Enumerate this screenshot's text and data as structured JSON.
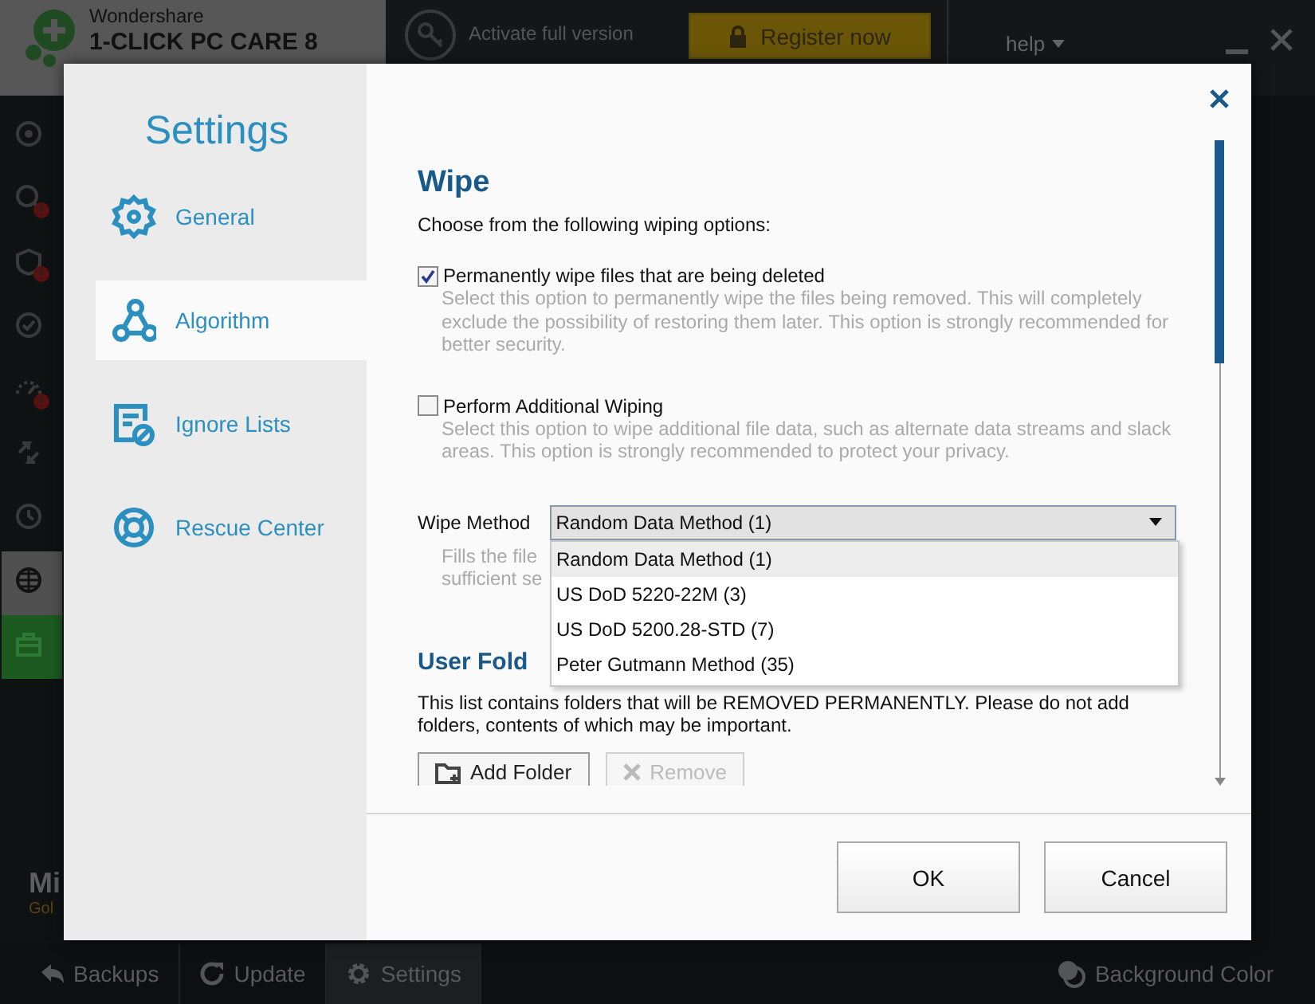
{
  "app": {
    "brand": "Wondershare",
    "product": "1-CLICK PC CARE 8",
    "activate": "Activate full version",
    "register": "Register now",
    "help": "help",
    "side_icons": [
      {
        "kind": "target",
        "alert": false,
        "selected": false
      },
      {
        "kind": "search",
        "alert": true,
        "selected": false
      },
      {
        "kind": "shield",
        "alert": true,
        "selected": false
      },
      {
        "kind": "check",
        "alert": false,
        "selected": false
      },
      {
        "kind": "gauge",
        "alert": true,
        "selected": false
      },
      {
        "kind": "arrows",
        "alert": false,
        "selected": false
      },
      {
        "kind": "clock",
        "alert": false,
        "selected": false
      },
      {
        "kind": "globe",
        "alert": false,
        "selected": true
      },
      {
        "kind": "toolbox",
        "alert": false,
        "selected": false
      }
    ],
    "panel_title": "Mi",
    "panel_subtitle": "Gol"
  },
  "bottom_bar": {
    "tabs": [
      {
        "kind": "back",
        "label": "Backups",
        "selected": false
      },
      {
        "kind": "refresh",
        "label": "Update",
        "selected": false
      },
      {
        "kind": "gear",
        "label": "Settings",
        "selected": true
      }
    ],
    "background_color": "Background Color"
  },
  "dialog": {
    "title": "Settings",
    "nav": [
      {
        "kind": "gear",
        "label": "General",
        "selected": false
      },
      {
        "kind": "nodes",
        "label": "Algorithm",
        "selected": true
      },
      {
        "kind": "list",
        "label": "Ignore Lists",
        "selected": false
      },
      {
        "kind": "lifebuoy",
        "label": "Rescue Center",
        "selected": false
      }
    ],
    "heading": "Wipe",
    "intro": "Choose from the following wiping options:",
    "options": [
      {
        "label": "Permanently wipe files that are being deleted",
        "checked": true,
        "description": "Select this option to permanently wipe the files being removed. This will completely exclude the possibility of restoring them later. This option is strongly recommended for better security."
      },
      {
        "label": "Perform Additional Wiping",
        "checked": false,
        "description": "Select this option to wipe additional file data, such as alternate data streams and slack areas. This option is strongly recommended to protect your privacy."
      }
    ],
    "wipe_method": {
      "label": "Wipe Method",
      "value": "Random Data Method (1)",
      "expanded": true,
      "options": [
        {
          "label": "Random Data Method (1)",
          "selected": true
        },
        {
          "label": "US DoD 5220-22M (3)",
          "selected": false
        },
        {
          "label": "US DoD 5200.28-STD (7)",
          "selected": false
        },
        {
          "label": "Peter Gutmann Method (35)",
          "selected": false
        }
      ],
      "description_lines": [
        "Fills the file",
        "sufficient se"
      ]
    },
    "folders_heading": "User Fold",
    "folders_text": "This list contains folders that will be REMOVED PERMANENTLY. Please do not add folders, contents of which may be important.",
    "folder_buttons": [
      {
        "kind": "add",
        "label": "Add Folder",
        "disabled": false
      },
      {
        "kind": "remove",
        "label": "Remove",
        "disabled": true
      }
    ],
    "buttons": [
      "OK",
      "Cancel"
    ]
  }
}
